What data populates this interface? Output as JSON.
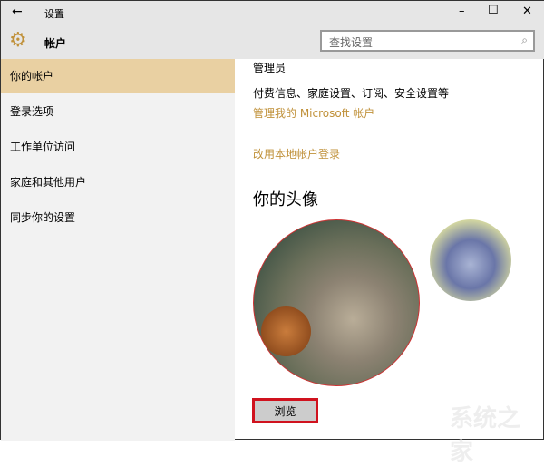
{
  "window": {
    "title": "设置",
    "back": "←",
    "minimize": "–",
    "maximize": "☐",
    "close": "✕"
  },
  "header": {
    "section": "帐户",
    "search_placeholder": "查找设置"
  },
  "sidebar": {
    "items": [
      {
        "label": "你的帐户"
      },
      {
        "label": "登录选项"
      },
      {
        "label": "工作单位访问"
      },
      {
        "label": "家庭和其他用户"
      },
      {
        "label": "同步你的设置"
      }
    ]
  },
  "main": {
    "role": "管理员",
    "billing": "付费信息、家庭设置、订阅、安全设置等",
    "manage_link": "管理我的 Microsoft 帐户",
    "local_link": "改用本地帐户登录",
    "avatar_heading": "你的头像",
    "browse": "浏览"
  },
  "watermark": "系统之家",
  "colors": {
    "accent": "#c0913a",
    "selected": "#e9d0a2",
    "highlight_border": "#d0121e"
  }
}
